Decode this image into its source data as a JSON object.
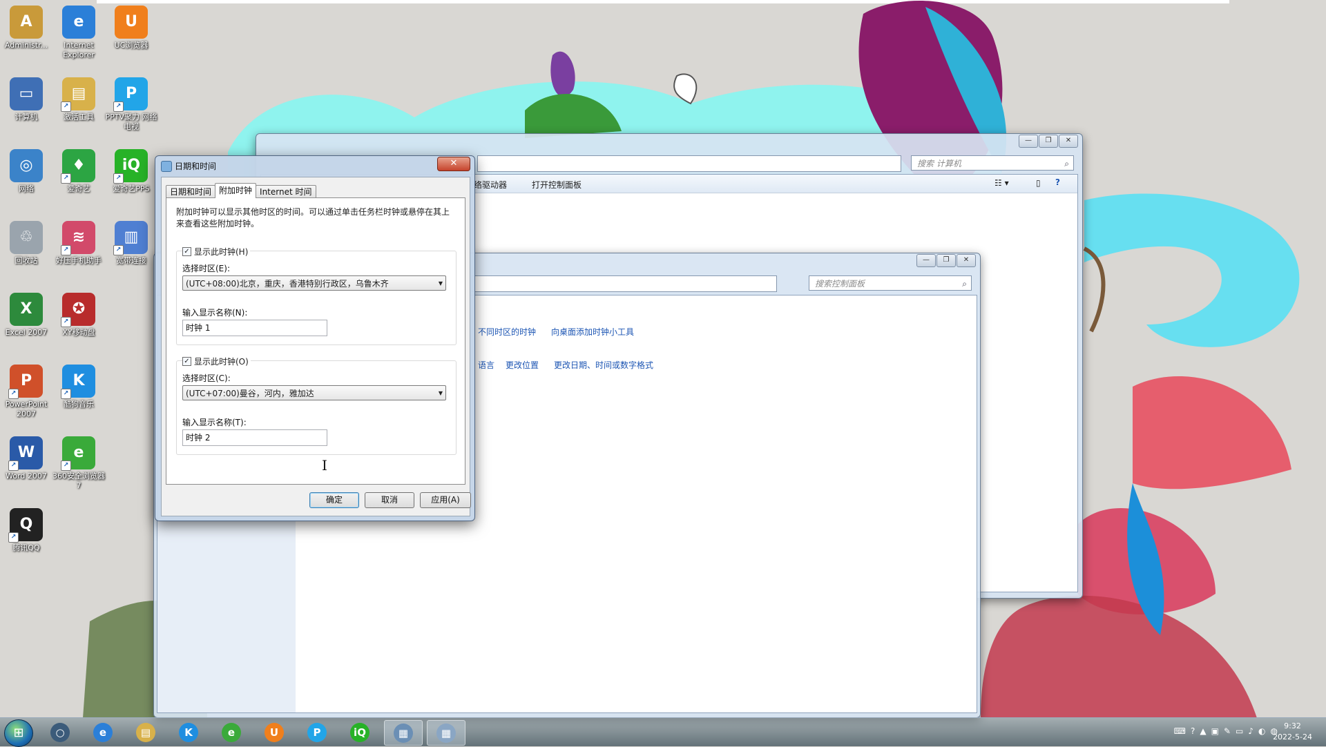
{
  "desktop": {
    "icons": [
      {
        "label": "Administr...",
        "glyph": "A",
        "color": "#c99a3a"
      },
      {
        "label": "Internet Explorer",
        "glyph": "e",
        "color": "#2b7fd8"
      },
      {
        "label": "UC浏览器",
        "glyph": "U",
        "color": "#f07f1c"
      },
      {
        "label": "计算机",
        "glyph": "▭",
        "color": "#3f6fb5"
      },
      {
        "label": "激活工具",
        "glyph": "▤",
        "color": "#d8b14a"
      },
      {
        "label": "PPTV聚力 网络电视",
        "glyph": "P",
        "color": "#22a5e8"
      },
      {
        "label": "网络",
        "glyph": "◎",
        "color": "#3b83c9"
      },
      {
        "label": "爱奇艺",
        "glyph": "♦",
        "color": "#2ca543"
      },
      {
        "label": "爱奇艺PPS",
        "glyph": "iQ",
        "color": "#27b227"
      },
      {
        "label": "回收站",
        "glyph": "♲",
        "color": "#9aa4ad"
      },
      {
        "label": "好压手机助手",
        "glyph": "≋",
        "color": "#d24a6a"
      },
      {
        "label": "宽带连接",
        "glyph": "▥",
        "color": "#4f7fd2"
      },
      {
        "label": "Excel 2007",
        "glyph": "X",
        "color": "#2d8a3c"
      },
      {
        "label": "XY移动盘",
        "glyph": "✪",
        "color": "#b82c2c"
      },
      {
        "label": "PowerPoint 2007",
        "glyph": "P",
        "color": "#d0502a"
      },
      {
        "label": "酷狗音乐",
        "glyph": "K",
        "color": "#1f8ee0"
      },
      {
        "label": "Word 2007",
        "glyph": "W",
        "color": "#2a5aa8"
      },
      {
        "label": "360安全浏览器7",
        "glyph": "e",
        "color": "#3aaa3a"
      },
      {
        "label": "腾讯QQ",
        "glyph": "Q",
        "color": "#222"
      }
    ]
  },
  "computer_window": {
    "search_placeholder": "搜索 计算机",
    "toolbar_items": [
      "络驱动器",
      "打开控制面板"
    ],
    "controls": [
      "—",
      "❐",
      "✕"
    ]
  },
  "control_panel_window": {
    "search_placeholder": "搜索控制面板",
    "links_row1": [
      "不同时区的时钟",
      "向桌面添加时钟小工具"
    ],
    "links_row2": [
      "语言",
      "更改位置",
      "更改日期、时间或数字格式"
    ],
    "controls": [
      "—",
      "❐",
      "✕"
    ]
  },
  "dialog": {
    "title": "日期和时间",
    "close": "✕",
    "tabs": [
      "日期和时间",
      "附加时钟",
      "Internet 时间"
    ],
    "description": "附加时钟可以显示其他时区的时间。可以通过单击任务栏时钟或悬停在其上来查看这些附加时钟。",
    "clock1": {
      "show_label": "显示此时钟(H)",
      "checked": "✓",
      "tz_label": "选择时区(E):",
      "tz_value": "(UTC+08:00)北京，重庆，香港特别行政区，乌鲁木齐",
      "name_label": "输入显示名称(N):",
      "name_value": "时钟 1"
    },
    "clock2": {
      "show_label": "显示此时钟(O)",
      "checked": "✓",
      "tz_label": "选择时区(C):",
      "tz_value": "(UTC+07:00)曼谷，河内，雅加达",
      "name_label": "输入显示名称(T):",
      "name_value": "时钟 2"
    },
    "buttons": {
      "ok": "确定",
      "cancel": "取消",
      "apply": "应用(A)"
    }
  },
  "taskbar": {
    "items": [
      {
        "glyph": "○"
      },
      {
        "glyph": "e"
      },
      {
        "glyph": "▤"
      },
      {
        "glyph": "K"
      },
      {
        "glyph": "e"
      },
      {
        "glyph": "U"
      },
      {
        "glyph": "P"
      },
      {
        "glyph": "iQ"
      },
      {
        "glyph": "▦"
      },
      {
        "glyph": "▦"
      }
    ],
    "tray_icons": [
      "⌨",
      "?",
      "▲",
      "▣",
      "✎",
      "▭",
      "♪",
      "◐",
      "◍"
    ],
    "clock_time": "9:32",
    "clock_date": "2022-5-24"
  }
}
